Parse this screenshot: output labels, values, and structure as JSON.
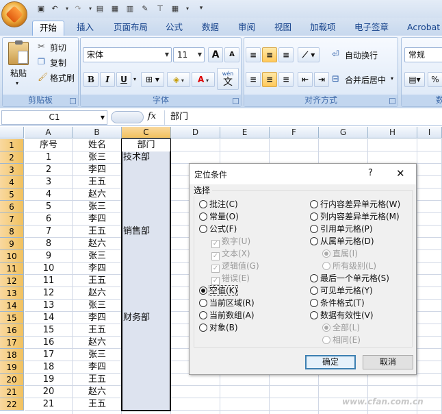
{
  "qat": {
    "undo_icon": "undo-icon",
    "redo_icon": "redo-icon"
  },
  "tabs": [
    "开始",
    "插入",
    "页面布局",
    "公式",
    "数据",
    "审阅",
    "视图",
    "加载项",
    "电子签章",
    "Acrobat"
  ],
  "clipboard": {
    "paste": "粘贴",
    "cut": "剪切",
    "copy": "复制",
    "format_painter": "格式刷",
    "group_label": "剪贴板"
  },
  "font": {
    "name": "宋体",
    "size": "11",
    "grow": "A",
    "shrink": "A",
    "bold": "B",
    "italic": "I",
    "underline": "U",
    "wen": "wén",
    "wen_char": "文",
    "group_label": "字体"
  },
  "alignment": {
    "wrap": "自动换行",
    "merge": "合并后居中",
    "group_label": "对齐方式"
  },
  "number": {
    "format": "常规",
    "percent": "%",
    "group_label": "数"
  },
  "formula_bar": {
    "name_box": "C1",
    "fx": "fx",
    "content": "部门"
  },
  "columns": [
    "A",
    "B",
    "C",
    "D",
    "E",
    "F",
    "G",
    "H",
    "I"
  ],
  "rows": [
    "1",
    "2",
    "3",
    "4",
    "5",
    "6",
    "7",
    "8",
    "9",
    "10",
    "11",
    "12",
    "13",
    "14",
    "15",
    "16",
    "17",
    "18",
    "19",
    "20",
    "21",
    "22"
  ],
  "col_a": [
    "序号",
    "1",
    "2",
    "3",
    "4",
    "5",
    "6",
    "7",
    "8",
    "9",
    "10",
    "11",
    "12",
    "13",
    "14",
    "15",
    "16",
    "17",
    "18",
    "19",
    "20",
    "21"
  ],
  "col_b": [
    "姓名",
    "张三",
    "李四",
    "王五",
    "赵六",
    "张三",
    "李四",
    "王五",
    "赵六",
    "张三",
    "李四",
    "王五",
    "赵六",
    "张三",
    "李四",
    "王五",
    "赵六",
    "张三",
    "李四",
    "王五",
    "赵六",
    "王五"
  ],
  "col_c": {
    "header": "部门",
    "dept1": "技术部",
    "dept2": "销售部",
    "dept3": "财务部"
  },
  "dialog": {
    "title": "定位条件",
    "help": "?",
    "close": "✕",
    "section": "选择",
    "left": [
      {
        "label": "批注(C)",
        "checked": false,
        "kind": "radio",
        "disabled": false
      },
      {
        "label": "常量(O)",
        "checked": false,
        "kind": "radio",
        "disabled": false
      },
      {
        "label": "公式(F)",
        "checked": false,
        "kind": "radio",
        "disabled": false
      },
      {
        "label": "数字(U)",
        "checked": true,
        "kind": "check",
        "disabled": true
      },
      {
        "label": "文本(X)",
        "checked": true,
        "kind": "check",
        "disabled": true
      },
      {
        "label": "逻辑值(G)",
        "checked": true,
        "kind": "check",
        "disabled": true
      },
      {
        "label": "错误(E)",
        "checked": true,
        "kind": "check",
        "disabled": true
      },
      {
        "label": "空值(K)",
        "checked": true,
        "kind": "radio",
        "disabled": false
      },
      {
        "label": "当前区域(R)",
        "checked": false,
        "kind": "radio",
        "disabled": false
      },
      {
        "label": "当前数组(A)",
        "checked": false,
        "kind": "radio",
        "disabled": false
      },
      {
        "label": "对象(B)",
        "checked": false,
        "kind": "radio",
        "disabled": false
      }
    ],
    "right": [
      {
        "label": "行内容差异单元格(W)",
        "checked": false,
        "kind": "radio",
        "disabled": false
      },
      {
        "label": "列内容差异单元格(M)",
        "checked": false,
        "kind": "radio",
        "disabled": false
      },
      {
        "label": "引用单元格(P)",
        "checked": false,
        "kind": "radio",
        "disabled": false
      },
      {
        "label": "从属单元格(D)",
        "checked": false,
        "kind": "radio",
        "disabled": false
      },
      {
        "label": "直属(I)",
        "checked": true,
        "kind": "radio",
        "disabled": true
      },
      {
        "label": "所有级别(L)",
        "checked": false,
        "kind": "radio",
        "disabled": true
      },
      {
        "label": "最后一个单元格(S)",
        "checked": false,
        "kind": "radio",
        "disabled": false
      },
      {
        "label": "可见单元格(Y)",
        "checked": false,
        "kind": "radio",
        "disabled": false
      },
      {
        "label": "条件格式(T)",
        "checked": false,
        "kind": "radio",
        "disabled": false
      },
      {
        "label": "数据有效性(V)",
        "checked": false,
        "kind": "radio",
        "disabled": false
      },
      {
        "label": "全部(L)",
        "checked": true,
        "kind": "radio",
        "disabled": true
      },
      {
        "label": "相同(E)",
        "checked": false,
        "kind": "radio",
        "disabled": true
      }
    ],
    "ok": "确定",
    "cancel": "取消"
  },
  "watermark": "www.cfan.com.cn"
}
